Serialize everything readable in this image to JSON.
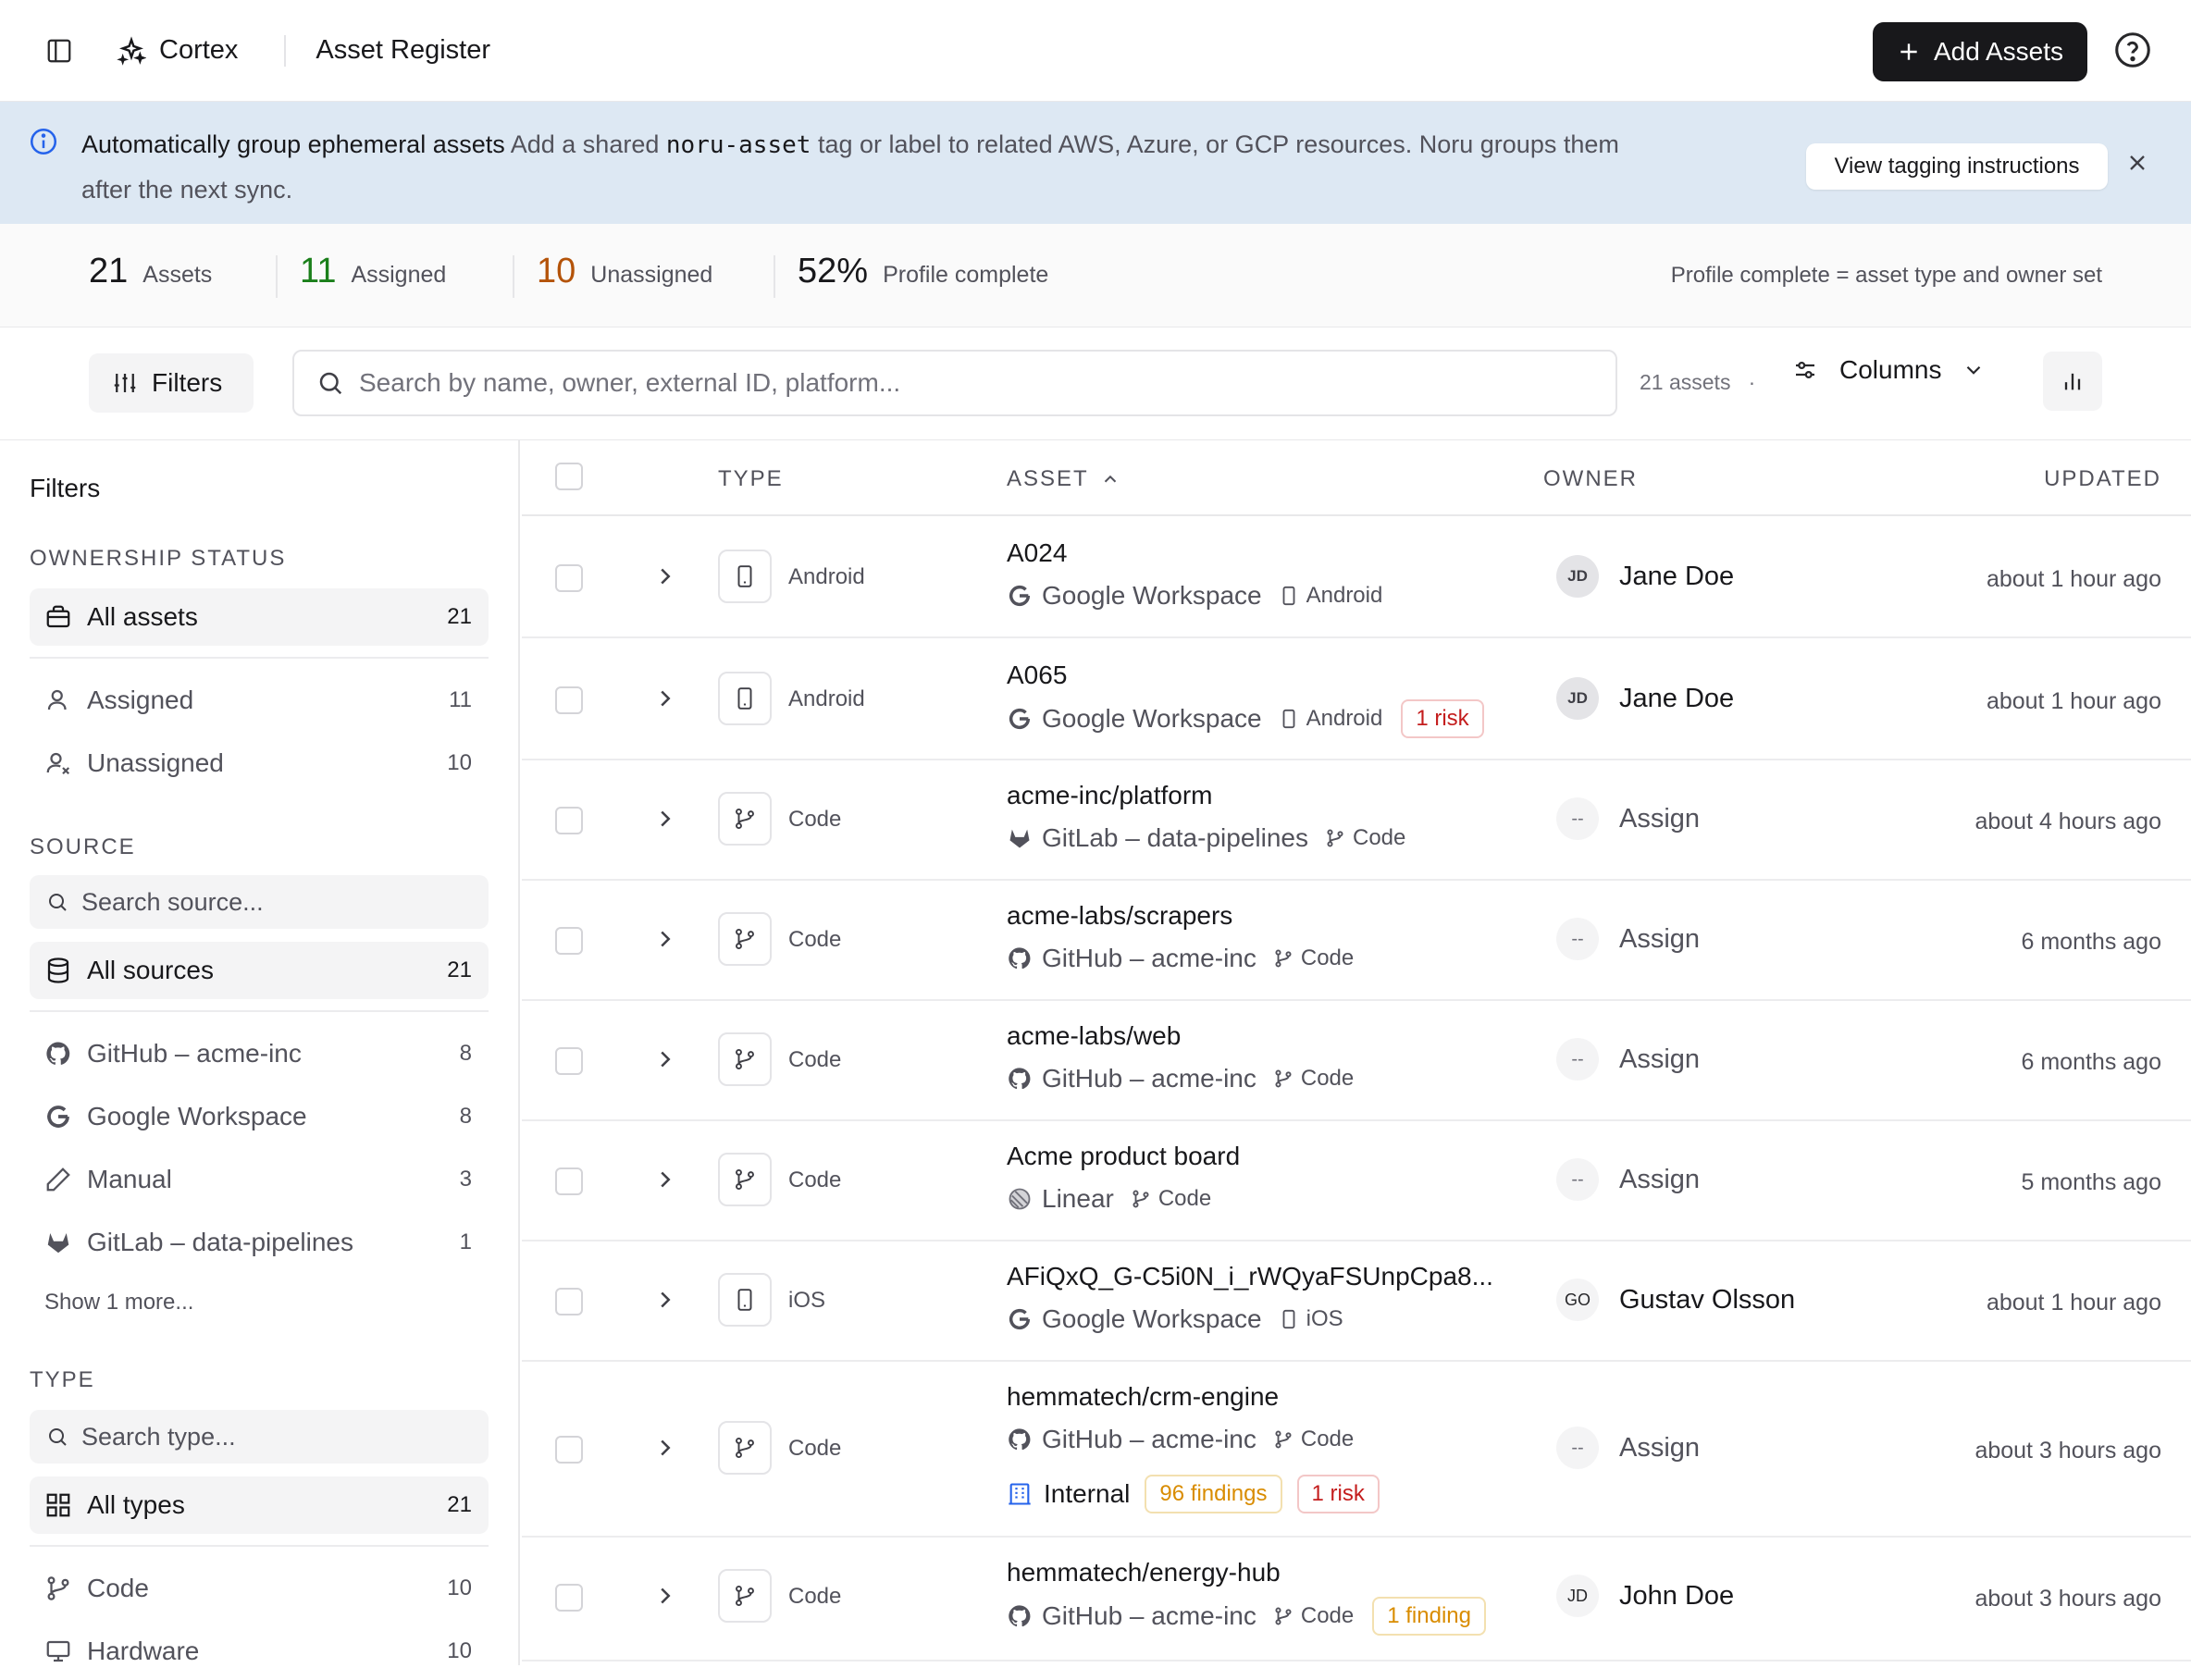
{
  "app": {
    "name": "Cortex",
    "page_title": "Asset Register",
    "add_label": "Add Assets"
  },
  "banner": {
    "title": "Automatically group ephemeral assets",
    "text_before": "Add a shared",
    "code": "noru-asset",
    "text_after1": "tag or label to related AWS, Azure, or GCP resources. Noru groups them",
    "text_after2": "after the next sync.",
    "action": "View tagging instructions"
  },
  "stats": {
    "total": {
      "value": "21",
      "label": "Assets"
    },
    "assigned": {
      "value": "11",
      "label": "Assigned",
      "color": "#1a7f1a"
    },
    "unassigned": {
      "value": "10",
      "label": "Unassigned",
      "color": "#b45309"
    },
    "profile": {
      "value": "52%",
      "label": "Profile complete"
    },
    "note": "Profile complete = asset type and owner set"
  },
  "toolbar": {
    "filters_label": "Filters",
    "search_placeholder": "Search by name, owner, external ID, platform...",
    "count": "21 assets",
    "dot": "·",
    "columns_label": "Columns"
  },
  "sidebar": {
    "title": "Filters",
    "ownership": {
      "heading": "OWNERSHIP STATUS",
      "items": [
        {
          "label": "All assets",
          "count": "21"
        },
        {
          "label": "Assigned",
          "count": "11"
        },
        {
          "label": "Unassigned",
          "count": "10"
        }
      ]
    },
    "source": {
      "heading": "SOURCE",
      "search_placeholder": "Search source...",
      "items": [
        {
          "label": "All sources",
          "count": "21"
        },
        {
          "label": "GitHub – acme-inc",
          "count": "8"
        },
        {
          "label": "Google Workspace",
          "count": "8"
        },
        {
          "label": "Manual",
          "count": "3"
        },
        {
          "label": "GitLab – data-pipelines",
          "count": "1"
        }
      ],
      "more": "Show 1 more..."
    },
    "type": {
      "heading": "TYPE",
      "search_placeholder": "Search type...",
      "items": [
        {
          "label": "All types",
          "count": "21"
        },
        {
          "label": "Code",
          "count": "10"
        },
        {
          "label": "Hardware",
          "count": "10"
        }
      ]
    }
  },
  "table": {
    "headers": {
      "type": "TYPE",
      "asset": "ASSET",
      "owner": "OWNER",
      "updated": "UPDATED"
    },
    "rows": [
      {
        "type": "Android",
        "name": "A024",
        "source": "Google Workspace",
        "sub": "Android",
        "owner_initials": "JD",
        "owner": "Jane Doe",
        "updated": "about 1 hour ago"
      },
      {
        "type": "Android",
        "name": "A065",
        "source": "Google Workspace",
        "sub": "Android",
        "risk": "1 risk",
        "owner_initials": "JD",
        "owner": "Jane Doe",
        "updated": "about 1 hour ago"
      },
      {
        "type": "Code",
        "name": "acme-inc/platform",
        "source": "GitLab – data-pipelines",
        "sub": "Code",
        "owner_initials": "--",
        "owner": "Assign",
        "updated": "about 4 hours ago"
      },
      {
        "type": "Code",
        "name": "acme-labs/scrapers",
        "source": "GitHub – acme-inc",
        "sub": "Code",
        "owner_initials": "--",
        "owner": "Assign",
        "updated": "6 months ago"
      },
      {
        "type": "Code",
        "name": "acme-labs/web",
        "source": "GitHub – acme-inc",
        "sub": "Code",
        "owner_initials": "--",
        "owner": "Assign",
        "updated": "6 months ago"
      },
      {
        "type": "Code",
        "name": "Acme product board",
        "source": "Linear",
        "sub": "Code",
        "owner_initials": "--",
        "owner": "Assign",
        "updated": "5 months ago"
      },
      {
        "type": "iOS",
        "name": "AFiQxQ_G-C5i0N_i_rWQyaFSUnpCpa8...",
        "source": "Google Workspace",
        "sub": "iOS",
        "owner_initials": "GO",
        "owner": "Gustav Olsson",
        "updated": "about 1 hour ago"
      },
      {
        "type": "Code",
        "name": "hemmatech/crm-engine",
        "source": "GitHub – acme-inc",
        "sub": "Code",
        "tag": "Internal",
        "findings": "96 findings",
        "risk": "1 risk",
        "owner_initials": "--",
        "owner": "Assign",
        "updated": "about 3 hours ago"
      },
      {
        "type": "Code",
        "name": "hemmatech/energy-hub",
        "source": "GitHub – acme-inc",
        "sub": "Code",
        "findings": "1 finding",
        "owner_initials": "JD",
        "owner": "John Doe",
        "updated": "about 3 hours ago"
      }
    ]
  },
  "icons": [
    "sidebar-toggle-icon",
    "sparkle-icon",
    "plus-icon",
    "help-icon",
    "info-icon",
    "close-icon",
    "sliders-icon",
    "search-icon",
    "settings-sliders-icon",
    "chevron-down-icon",
    "bar-chart-icon",
    "briefcase-icon",
    "user-icon",
    "user-x-icon",
    "database-icon",
    "github-icon",
    "google-icon",
    "pen-icon",
    "gitlab-icon",
    "grid-icon",
    "git-branch-icon",
    "monitor-icon",
    "phone-icon",
    "linear-icon",
    "building-icon",
    "chevron-right-icon",
    "chevron-up-icon"
  ]
}
